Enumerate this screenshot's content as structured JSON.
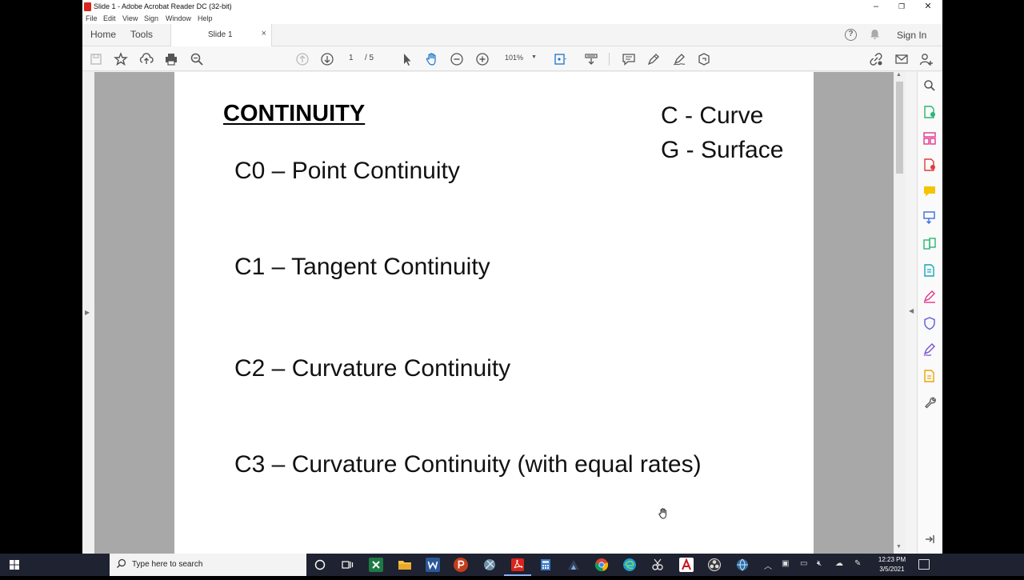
{
  "window": {
    "title": "Slide 1 - Adobe Acrobat Reader DC (32-bit)",
    "minimize": "–",
    "restore": "❐",
    "close": "✕"
  },
  "menu": [
    "File",
    "Edit",
    "View",
    "Sign",
    "Window",
    "Help"
  ],
  "tabs": {
    "home": "Home",
    "tools": "Tools",
    "document": "Slide 1",
    "close": "×",
    "sign_in": "Sign In",
    "help": "?"
  },
  "toolbar": {
    "page_current": "1",
    "page_total": "/ 5",
    "zoom": "101%"
  },
  "document": {
    "heading": "CONTINUITY",
    "lines": [
      "C0 – Point Continuity",
      "C1 – Tangent Continuity",
      "C2 – Curvature Continuity",
      "C3 – Curvature Continuity (with equal rates)"
    ],
    "legend": [
      "C - Curve",
      "G - Surface"
    ]
  },
  "taskbar": {
    "search_placeholder": "Type here to search",
    "time": "12:23 PM",
    "date": "3/5/2021"
  },
  "colors": {
    "acrobat_red": "#d9251c",
    "taskbar": "#1f2230",
    "doc_background": "#a8a8a8"
  }
}
